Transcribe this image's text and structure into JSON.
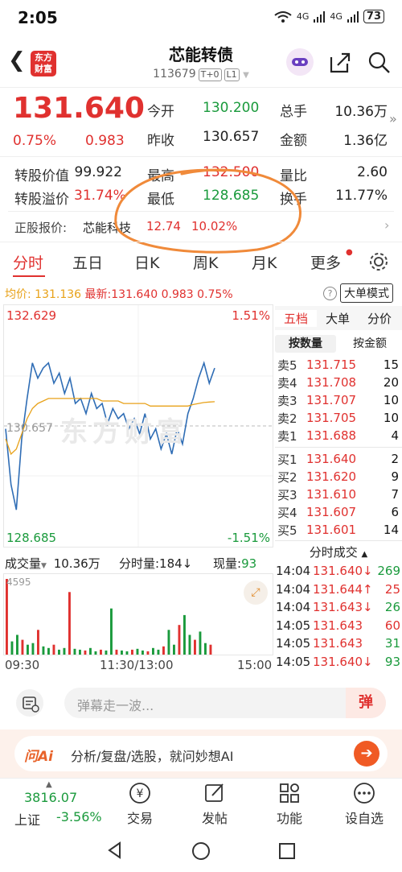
{
  "status": {
    "time": "2:05",
    "battery": "73",
    "net1": "4G",
    "net2": "4G"
  },
  "header": {
    "logo_line1": "东方",
    "logo_line2": "财富",
    "title": "芯能转债",
    "code": "113679",
    "tag1": "T+0",
    "tag2": "L1"
  },
  "quote": {
    "price": "131.640",
    "change_pct": "0.75%",
    "change": "0.983",
    "fields": [
      {
        "label": "今开",
        "value": "130.200",
        "color": "green"
      },
      {
        "label": "总手",
        "value": "10.36万",
        "color": "dark"
      },
      {
        "label": "昨收",
        "value": "130.657",
        "color": "dark"
      },
      {
        "label": "金额",
        "value": "1.36亿",
        "color": "dark"
      }
    ],
    "row2": [
      {
        "label": "转股价值",
        "value": "99.922",
        "color": "dark"
      },
      {
        "label": "最高",
        "value": "132.500",
        "color": "red"
      },
      {
        "label": "量比",
        "value": "2.60",
        "color": "dark"
      }
    ],
    "row3": [
      {
        "label": "转股溢价",
        "value": "31.74%",
        "color": "red"
      },
      {
        "label": "最低",
        "value": "128.685",
        "color": "green"
      },
      {
        "label": "换手",
        "value": "11.77%",
        "color": "dark"
      }
    ],
    "stock_label": "正股报价:",
    "stock_name": "芯能科技",
    "stock_price": "12.74",
    "stock_pct": "10.02%"
  },
  "tabs": [
    "分时",
    "五日",
    "日K",
    "周K",
    "月K",
    "更多"
  ],
  "chart_header": {
    "avg_label": "均价:",
    "avg_value": "131.136",
    "latest_label": "最新:",
    "latest_value": "131.640",
    "latest_change": "0.983",
    "latest_pct": "0.75%",
    "mode_button": "大单模式"
  },
  "chart_labels": {
    "y_high": "132.629",
    "y_mid": "130.657",
    "y_low": "128.685",
    "pct_high": "1.51%",
    "pct_low": "-1.51%",
    "vol_label": "成交量",
    "vol_total": "10.36万",
    "vol_minute": "分时量:184↓",
    "vol_now_label": "现量:",
    "vol_now": "93",
    "vol_max": "4595",
    "x_start": "09:30",
    "x_mid": "11:30/13:00",
    "x_end": "15:00",
    "watermark": "东方财富"
  },
  "chart_data": {
    "type": "line",
    "title": "",
    "ylim": [
      128.685,
      132.629
    ],
    "series": [
      {
        "values": [
          130.6,
          129.5,
          129.0,
          130.4,
          131.2,
          131.9,
          131.6,
          131.8,
          131.9,
          131.5,
          131.7,
          131.3,
          131.6,
          131.1,
          131.2,
          130.9,
          131.3,
          131.0,
          131.1,
          130.7,
          131.0,
          130.8,
          130.9,
          130.6,
          130.8,
          130.5,
          130.9,
          130.4,
          130.6,
          130.2,
          130.5,
          130.1,
          130.6,
          130.3,
          130.9,
          131.2,
          131.6,
          131.9,
          131.5,
          131.8
        ]
      },
      {
        "values": [
          130.4,
          130.1,
          130.2,
          130.5,
          130.8,
          131.0,
          131.1,
          131.15,
          131.2,
          131.2,
          131.2,
          131.2,
          131.2,
          131.2,
          131.2,
          131.2,
          131.2,
          131.2,
          131.15,
          131.15,
          131.15,
          131.15,
          131.1,
          131.1,
          131.1,
          131.1,
          131.1,
          131.05,
          131.05,
          131.05,
          131.05,
          131.05,
          131.05,
          131.05,
          131.05,
          131.08,
          131.1,
          131.12,
          131.13,
          131.136
        ]
      }
    ],
    "volume": [
      4595,
      800,
      1200,
      900,
      600,
      700,
      1500,
      500,
      400,
      600,
      300,
      400,
      3800,
      350,
      300,
      250,
      400,
      200,
      300,
      250,
      2800,
      300,
      250,
      200,
      300,
      350,
      250,
      200,
      400,
      300,
      500,
      1500,
      600,
      1800,
      2400,
      1200,
      900,
      1400,
      700,
      600
    ]
  },
  "orderbook": {
    "tab1": "五档",
    "tab2": "大单",
    "tab3": "分价",
    "sub1": "按数量",
    "sub2": "按金额",
    "asks": [
      {
        "k": "卖5",
        "p": "131.715",
        "q": "15"
      },
      {
        "k": "卖4",
        "p": "131.708",
        "q": "20"
      },
      {
        "k": "卖3",
        "p": "131.707",
        "q": "10"
      },
      {
        "k": "卖2",
        "p": "131.705",
        "q": "10"
      },
      {
        "k": "卖1",
        "p": "131.688",
        "q": "4"
      }
    ],
    "bids": [
      {
        "k": "买1",
        "p": "131.640",
        "q": "2"
      },
      {
        "k": "买2",
        "p": "131.620",
        "q": "9"
      },
      {
        "k": "买3",
        "p": "131.610",
        "q": "7"
      },
      {
        "k": "买4",
        "p": "131.607",
        "q": "6"
      },
      {
        "k": "买5",
        "p": "131.601",
        "q": "14"
      }
    ],
    "trades_title": "分时成交",
    "trades": [
      {
        "t": "14:04",
        "p": "131.640↓",
        "q": "269",
        "c": "green"
      },
      {
        "t": "14:04",
        "p": "131.644↑",
        "q": "25",
        "c": "red"
      },
      {
        "t": "14:04",
        "p": "131.643↓",
        "q": "26",
        "c": "green"
      },
      {
        "t": "14:05",
        "p": "131.643",
        "q": "60",
        "c": "red"
      },
      {
        "t": "14:05",
        "p": "131.643",
        "q": "31",
        "c": "green"
      },
      {
        "t": "14:05",
        "p": "131.640↓",
        "q": "93",
        "c": "green"
      }
    ]
  },
  "danmu": {
    "placeholder": "弹幕走一波...",
    "button": "弹"
  },
  "ai_bar": {
    "logo": "问Ai",
    "text": "分析/复盘/选股，就问妙想AI"
  },
  "bottom_nav": {
    "index_value": "3816.07",
    "index_name": "上证",
    "index_pct": "-3.56%",
    "items": [
      "交易",
      "发帖",
      "功能",
      "设自选"
    ]
  }
}
